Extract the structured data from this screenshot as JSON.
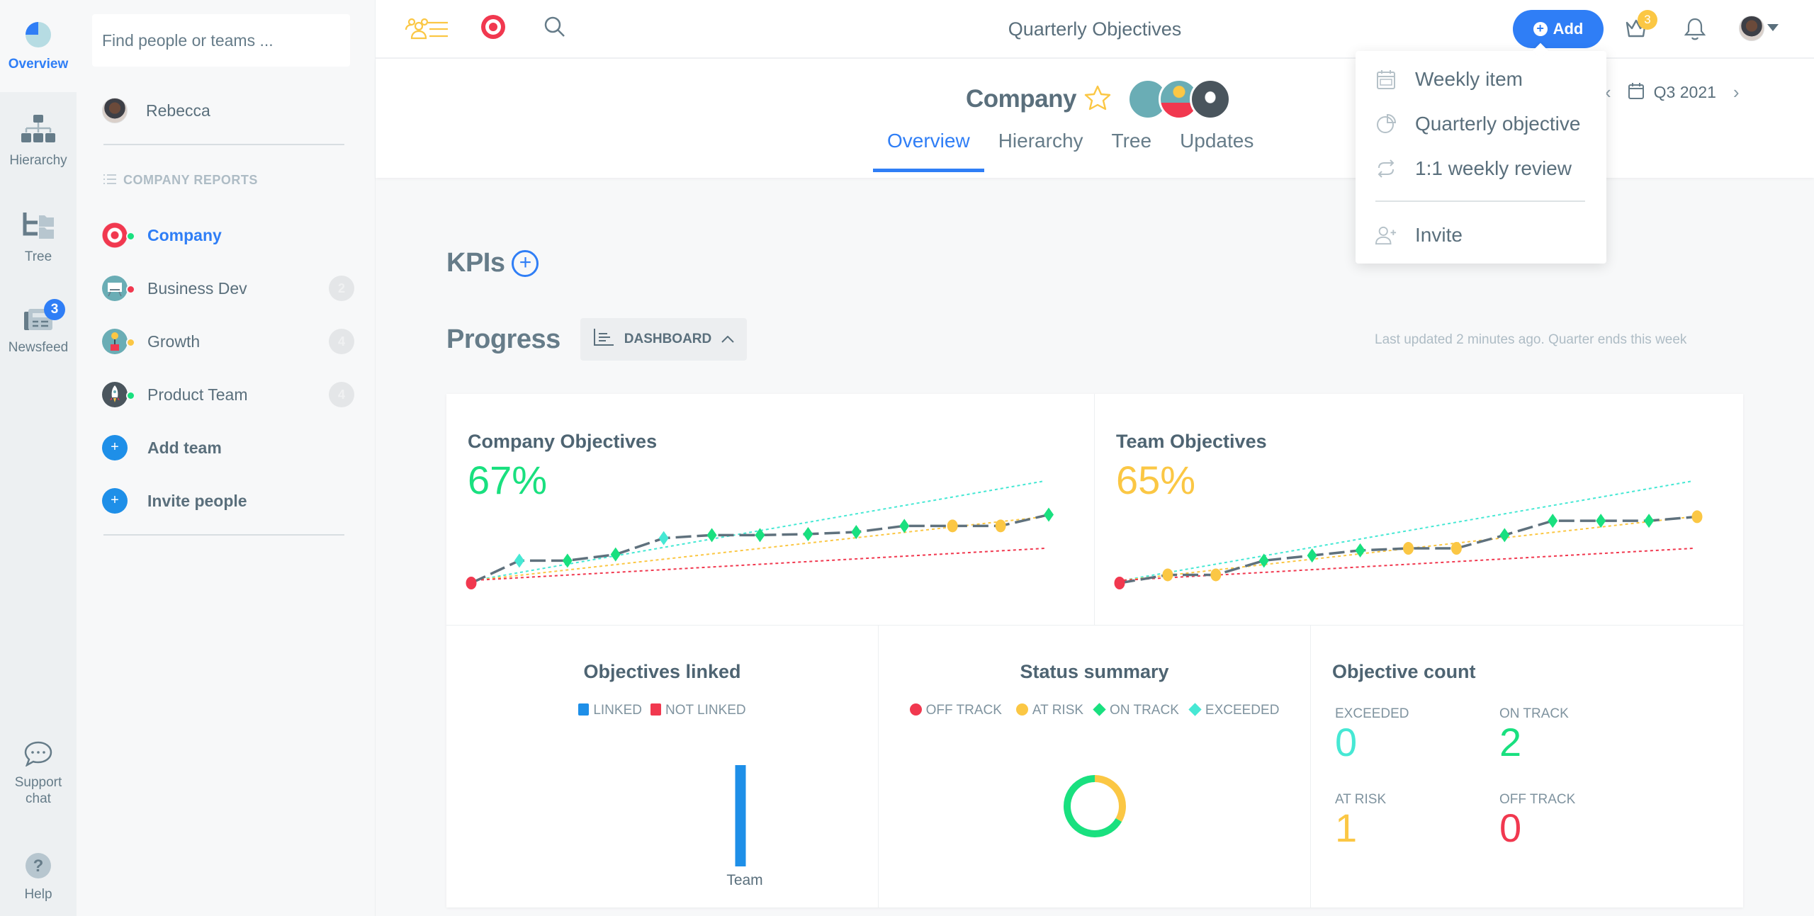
{
  "rail": {
    "items": [
      {
        "label": "Overview",
        "icon": "pie-chart-icon",
        "active": true
      },
      {
        "label": "Hierarchy",
        "icon": "hierarchy-icon"
      },
      {
        "label": "Tree",
        "icon": "tree-icon"
      },
      {
        "label": "Newsfeed",
        "icon": "newspaper-icon",
        "badge": "3"
      }
    ],
    "bottom": [
      {
        "label_line1": "Support",
        "label_line2": "chat",
        "icon": "chat-bubble-icon"
      },
      {
        "label": "Help",
        "icon": "help-icon"
      }
    ]
  },
  "sidebar": {
    "search_placeholder": "Find people or teams ...",
    "user": {
      "name": "Rebecca"
    },
    "section_title": "COMPANY REPORTS",
    "teams": [
      {
        "name": "Company",
        "status": "on-track",
        "active": true,
        "count": ""
      },
      {
        "name": "Business Dev",
        "status": "off-track",
        "count": "2"
      },
      {
        "name": "Growth",
        "status": "at-risk",
        "count": "4"
      },
      {
        "name": "Product Team",
        "status": "on-track",
        "count": "4"
      }
    ],
    "actions": [
      {
        "label": "Add team"
      },
      {
        "label": "Invite people"
      }
    ]
  },
  "header": {
    "title": "Quarterly Objectives",
    "add_label": "Add",
    "crown_badge": "3"
  },
  "add_menu": {
    "items": [
      {
        "label": "Weekly item",
        "icon": "calendar-icon"
      },
      {
        "label": "Quarterly objective",
        "icon": "pie-chart-icon"
      },
      {
        "label": "1:1 weekly review",
        "icon": "repeat-icon"
      }
    ],
    "invite_label": "Invite"
  },
  "subheader": {
    "team_name": "Company",
    "quarter": "Q3 2021",
    "tabs": [
      {
        "label": "Overview",
        "active": true
      },
      {
        "label": "Hierarchy"
      },
      {
        "label": "Tree"
      },
      {
        "label": "Updates"
      }
    ]
  },
  "body": {
    "kpis_title": "KPIs",
    "progress_title": "Progress",
    "dashboard_label": "DASHBOARD",
    "last_updated": "Last updated 2 minutes ago. Quarter ends this week"
  },
  "colors": {
    "accent": "#2f7ef6",
    "off_track": "#f1384f",
    "at_risk": "#fbc744",
    "on_track": "#19e07f",
    "exceeded": "#46e8d4",
    "line": "#5f717d",
    "linked": "#1e8fe8"
  },
  "chart_data": [
    {
      "type": "line",
      "title": "Company Objectives",
      "headline": "67%",
      "headline_status": "on_track",
      "x": [
        0,
        1,
        2,
        3,
        4,
        5,
        6,
        7,
        8,
        9,
        10,
        11,
        12
      ],
      "ylim": [
        0,
        100
      ],
      "series": [
        {
          "name": "Progress",
          "values": [
            0,
            22,
            22,
            28,
            44,
            47,
            47,
            48,
            50,
            56,
            56,
            56,
            67
          ],
          "statuses": [
            "off_track",
            "exceeded",
            "on_track",
            "on_track",
            "exceeded",
            "on_track",
            "on_track",
            "on_track",
            "on_track",
            "on_track",
            "at_risk",
            "at_risk",
            "on_track"
          ]
        }
      ],
      "guides": [
        {
          "name": "exceeded",
          "end": 100
        },
        {
          "name": "at_risk",
          "end": 65
        },
        {
          "name": "off_track",
          "end": 34
        }
      ]
    },
    {
      "type": "line",
      "title": "Team Objectives",
      "headline": "65%",
      "headline_status": "at_risk",
      "x": [
        0,
        1,
        2,
        3,
        4,
        5,
        6,
        7,
        8,
        9,
        10,
        11,
        12
      ],
      "ylim": [
        0,
        100
      ],
      "series": [
        {
          "name": "Progress",
          "values": [
            0,
            8,
            8,
            22,
            27,
            32,
            34,
            34,
            47,
            61,
            61,
            61,
            65
          ],
          "statuses": [
            "off_track",
            "at_risk",
            "at_risk",
            "on_track",
            "on_track",
            "on_track",
            "at_risk",
            "at_risk",
            "on_track",
            "on_track",
            "on_track",
            "on_track",
            "at_risk"
          ]
        }
      ],
      "guides": [
        {
          "name": "exceeded",
          "end": 100
        },
        {
          "name": "at_risk",
          "end": 65
        },
        {
          "name": "off_track",
          "end": 34
        }
      ]
    },
    {
      "type": "bar",
      "title": "Objectives linked",
      "legend": [
        "LINKED",
        "NOT LINKED"
      ],
      "categories": [
        "Team"
      ],
      "series": [
        {
          "name": "LINKED",
          "values": [
            1
          ]
        },
        {
          "name": "NOT LINKED",
          "values": [
            0
          ]
        }
      ]
    },
    {
      "type": "pie",
      "title": "Status summary",
      "legend": [
        "OFF TRACK",
        "AT RISK",
        "ON TRACK",
        "EXCEEDED"
      ],
      "slices": [
        {
          "label": "OFF TRACK",
          "value": 0,
          "key": "off_track"
        },
        {
          "label": "AT RISK",
          "value": 1,
          "key": "at_risk"
        },
        {
          "label": "ON TRACK",
          "value": 2,
          "key": "on_track"
        },
        {
          "label": "EXCEEDED",
          "value": 0,
          "key": "exceeded"
        }
      ]
    },
    {
      "type": "table",
      "title": "Objective count",
      "cells": [
        {
          "label": "EXCEEDED",
          "value": "0",
          "key": "exceeded"
        },
        {
          "label": "ON TRACK",
          "value": "2",
          "key": "on_track"
        },
        {
          "label": "AT RISK",
          "value": "1",
          "key": "at_risk"
        },
        {
          "label": "OFF TRACK",
          "value": "0",
          "key": "off_track"
        }
      ]
    }
  ]
}
